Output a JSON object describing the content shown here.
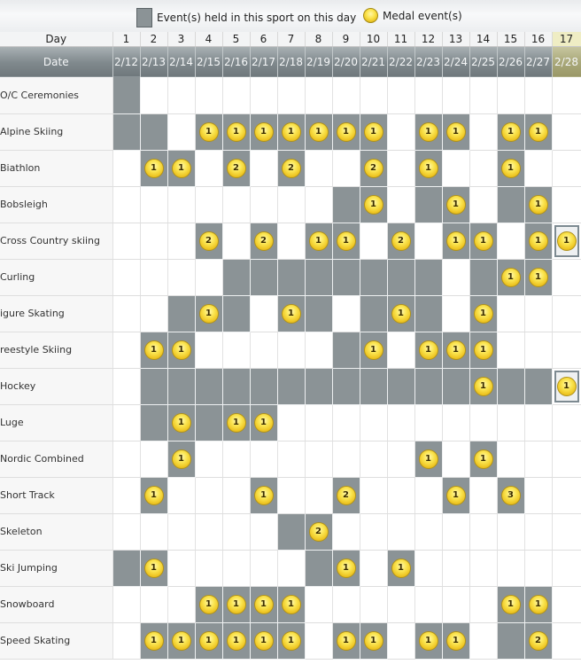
{
  "legend": {
    "held_label": "Event(s) held in this sport on this day",
    "medal_label": "Medal event(s)"
  },
  "header": {
    "day_label": "Day",
    "date_label": "Date",
    "days": [
      "1",
      "2",
      "3",
      "4",
      "5",
      "6",
      "7",
      "8",
      "9",
      "10",
      "11",
      "12",
      "13",
      "14",
      "15",
      "16",
      "17"
    ],
    "dates": [
      "2/12",
      "2/13",
      "2/14",
      "2/15",
      "2/16",
      "2/17",
      "2/18",
      "2/19",
      "2/20",
      "2/21",
      "2/22",
      "2/23",
      "2/24",
      "2/25",
      "2/26",
      "2/27",
      "2/28"
    ]
  },
  "colors": {
    "held": "#8b9396",
    "medal": "#f2cc28"
  },
  "sports": [
    {
      "name": "O/C Ceremonies",
      "cells": [
        "A",
        "",
        "",
        "",
        "",
        "",
        "",
        "",
        "",
        "",
        "",
        "",
        "",
        "",
        "",
        "",
        "M"
      ]
    },
    {
      "name": "Alpine Skiing",
      "cells": [
        "A",
        "A",
        "",
        "1",
        "1",
        "1",
        "1",
        "1",
        "1",
        "1",
        "",
        "1",
        "1",
        "",
        "1",
        "1",
        ""
      ]
    },
    {
      "name": "Biathlon",
      "cells": [
        "",
        "1",
        "1",
        "",
        "2",
        "",
        "2",
        "",
        "",
        "2",
        "",
        "1",
        "",
        "",
        "1",
        "",
        ""
      ]
    },
    {
      "name": "Bobsleigh",
      "cells": [
        "",
        "",
        "",
        "",
        "",
        "",
        "",
        "",
        "A",
        "1",
        "",
        "A",
        "1",
        "",
        "A",
        "1",
        ""
      ]
    },
    {
      "name": "Cross Country skiing",
      "cells": [
        "",
        "",
        "",
        "2",
        "",
        "2",
        "",
        "1",
        "1",
        "",
        "2",
        "",
        "1",
        "1",
        "",
        "1",
        "F1"
      ]
    },
    {
      "name": "Curling",
      "cells": [
        "",
        "",
        "",
        "",
        "A",
        "A",
        "A",
        "A",
        "A",
        "A",
        "A",
        "A",
        "",
        "A",
        "1",
        "1",
        ""
      ]
    },
    {
      "name": "Figure Skating",
      "cells": [
        "",
        "",
        "A",
        "1",
        "A",
        "",
        "1",
        "A",
        "",
        "A",
        "1",
        "A",
        "",
        "1",
        "",
        "",
        ""
      ]
    },
    {
      "name": "Freestyle Skiing",
      "cells": [
        "",
        "1",
        "1",
        "",
        "",
        "",
        "",
        "",
        "A",
        "1",
        "",
        "1",
        "1",
        "1",
        "",
        "",
        ""
      ]
    },
    {
      "name": "Hockey",
      "cells": [
        "",
        "A",
        "A",
        "A",
        "A",
        "A",
        "A",
        "A",
        "A",
        "A",
        "A",
        "A",
        "A",
        "1",
        "A",
        "A",
        "F1"
      ]
    },
    {
      "name": "Luge",
      "cells": [
        "",
        "A",
        "1",
        "A",
        "1",
        "1",
        "",
        "",
        "",
        "",
        "",
        "",
        "",
        "",
        "",
        "",
        ""
      ]
    },
    {
      "name": "Nordic Combined",
      "cells": [
        "",
        "",
        "1",
        "",
        "",
        "",
        "",
        "",
        "",
        "",
        "",
        "1",
        "",
        "1",
        "",
        "",
        ""
      ]
    },
    {
      "name": "Short Track",
      "cells": [
        "",
        "1",
        "",
        "",
        "",
        "1",
        "",
        "",
        "2",
        "",
        "",
        "",
        "1",
        "",
        "3",
        "",
        ""
      ]
    },
    {
      "name": "Skeleton",
      "cells": [
        "",
        "",
        "",
        "",
        "",
        "",
        "A",
        "2",
        "",
        "",
        "",
        "",
        "",
        "",
        "",
        "",
        ""
      ]
    },
    {
      "name": "Ski Jumping",
      "cells": [
        "A",
        "1",
        "",
        "",
        "",
        "",
        "",
        "A",
        "1",
        "",
        "1",
        "",
        "",
        "",
        "",
        "",
        ""
      ]
    },
    {
      "name": "Snowboard",
      "cells": [
        "",
        "",
        "",
        "1",
        "1",
        "1",
        "1",
        "",
        "",
        "",
        "",
        "",
        "",
        "",
        "1",
        "1",
        ""
      ]
    },
    {
      "name": "Speed Skating",
      "cells": [
        "",
        "1",
        "1",
        "1",
        "1",
        "1",
        "1",
        "",
        "1",
        "1",
        "",
        "1",
        "1",
        "",
        "A",
        "2",
        ""
      ]
    }
  ]
}
